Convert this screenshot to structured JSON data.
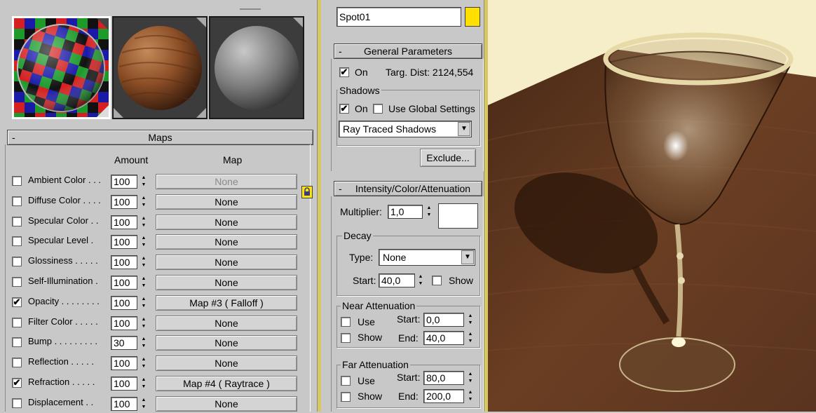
{
  "material_editor": {
    "slots": [
      {
        "name": "checker-material"
      },
      {
        "name": "wood-material"
      },
      {
        "name": "gray-material"
      }
    ],
    "maps": {
      "title": "Maps",
      "collapse": "-",
      "col_amount": "Amount",
      "col_map": "Map",
      "rows": [
        {
          "label": "Ambient Color . . .",
          "checked": false,
          "amount": "100",
          "map": "None",
          "dim": true
        },
        {
          "label": "Diffuse Color . . . .",
          "checked": false,
          "amount": "100",
          "map": "None"
        },
        {
          "label": "Specular Color . .",
          "checked": false,
          "amount": "100",
          "map": "None"
        },
        {
          "label": "Specular Level  .",
          "checked": false,
          "amount": "100",
          "map": "None"
        },
        {
          "label": "Glossiness . . . . .",
          "checked": false,
          "amount": "100",
          "map": "None"
        },
        {
          "label": "Self-Illumination .",
          "checked": false,
          "amount": "100",
          "map": "None"
        },
        {
          "label": "Opacity . . . . . . . .",
          "checked": true,
          "amount": "100",
          "map": "Map #3  ( Falloff )"
        },
        {
          "label": "Filter Color  . . . . .",
          "checked": false,
          "amount": "100",
          "map": "None"
        },
        {
          "label": "Bump  . . . . . . . . .",
          "checked": false,
          "amount": "30",
          "map": "None"
        },
        {
          "label": "Reflection  . . . . .",
          "checked": false,
          "amount": "100",
          "map": "None"
        },
        {
          "label": "Refraction  . . . . .",
          "checked": true,
          "amount": "100",
          "map": "Map #4  ( Raytrace )"
        },
        {
          "label": "Displacement  . .",
          "checked": false,
          "amount": "100",
          "map": "None"
        }
      ]
    }
  },
  "light": {
    "name": "Spot01",
    "color": "#ffe000",
    "general": {
      "title": "General Parameters",
      "collapse": "-",
      "on_label": "On",
      "on_checked": true,
      "targ_dist": "Targ. Dist: 2124,554",
      "shadows_title": "Shadows",
      "shadows_on_label": "On",
      "shadows_on_checked": true,
      "use_global_label": "Use Global Settings",
      "use_global_checked": false,
      "shadow_type": "Ray Traced Shadows",
      "exclude_label": "Exclude..."
    },
    "intensity": {
      "title": "Intensity/Color/Attenuation",
      "collapse": "-",
      "multiplier_label": "Multiplier:",
      "multiplier": "1,0",
      "swatch_color": "#ffffff",
      "decay_title": "Decay",
      "type_label": "Type:",
      "type_value": "None",
      "start_label": "Start:",
      "start_value": "40,0",
      "show_label": "Show",
      "near_title": "Near Attenuation",
      "near_use": "Use",
      "near_show": "Show",
      "near_start_label": "Start:",
      "near_start": "0,0",
      "near_end_label": "End:",
      "near_end": "40,0",
      "far_title": "Far Attenuation",
      "far_use": "Use",
      "far_show": "Show",
      "far_start_label": "Start:",
      "far_start": "80,0",
      "far_end_label": "End:",
      "far_end": "200,0"
    }
  },
  "icons": {
    "lock": "lock-icon",
    "dropdown": "dropdown-arrow-icon",
    "spinner": "spinner-arrows-icon"
  },
  "check_glyph": "✔",
  "spin_up": "▲",
  "spin_down": "▼",
  "dd_glyph": "▼"
}
